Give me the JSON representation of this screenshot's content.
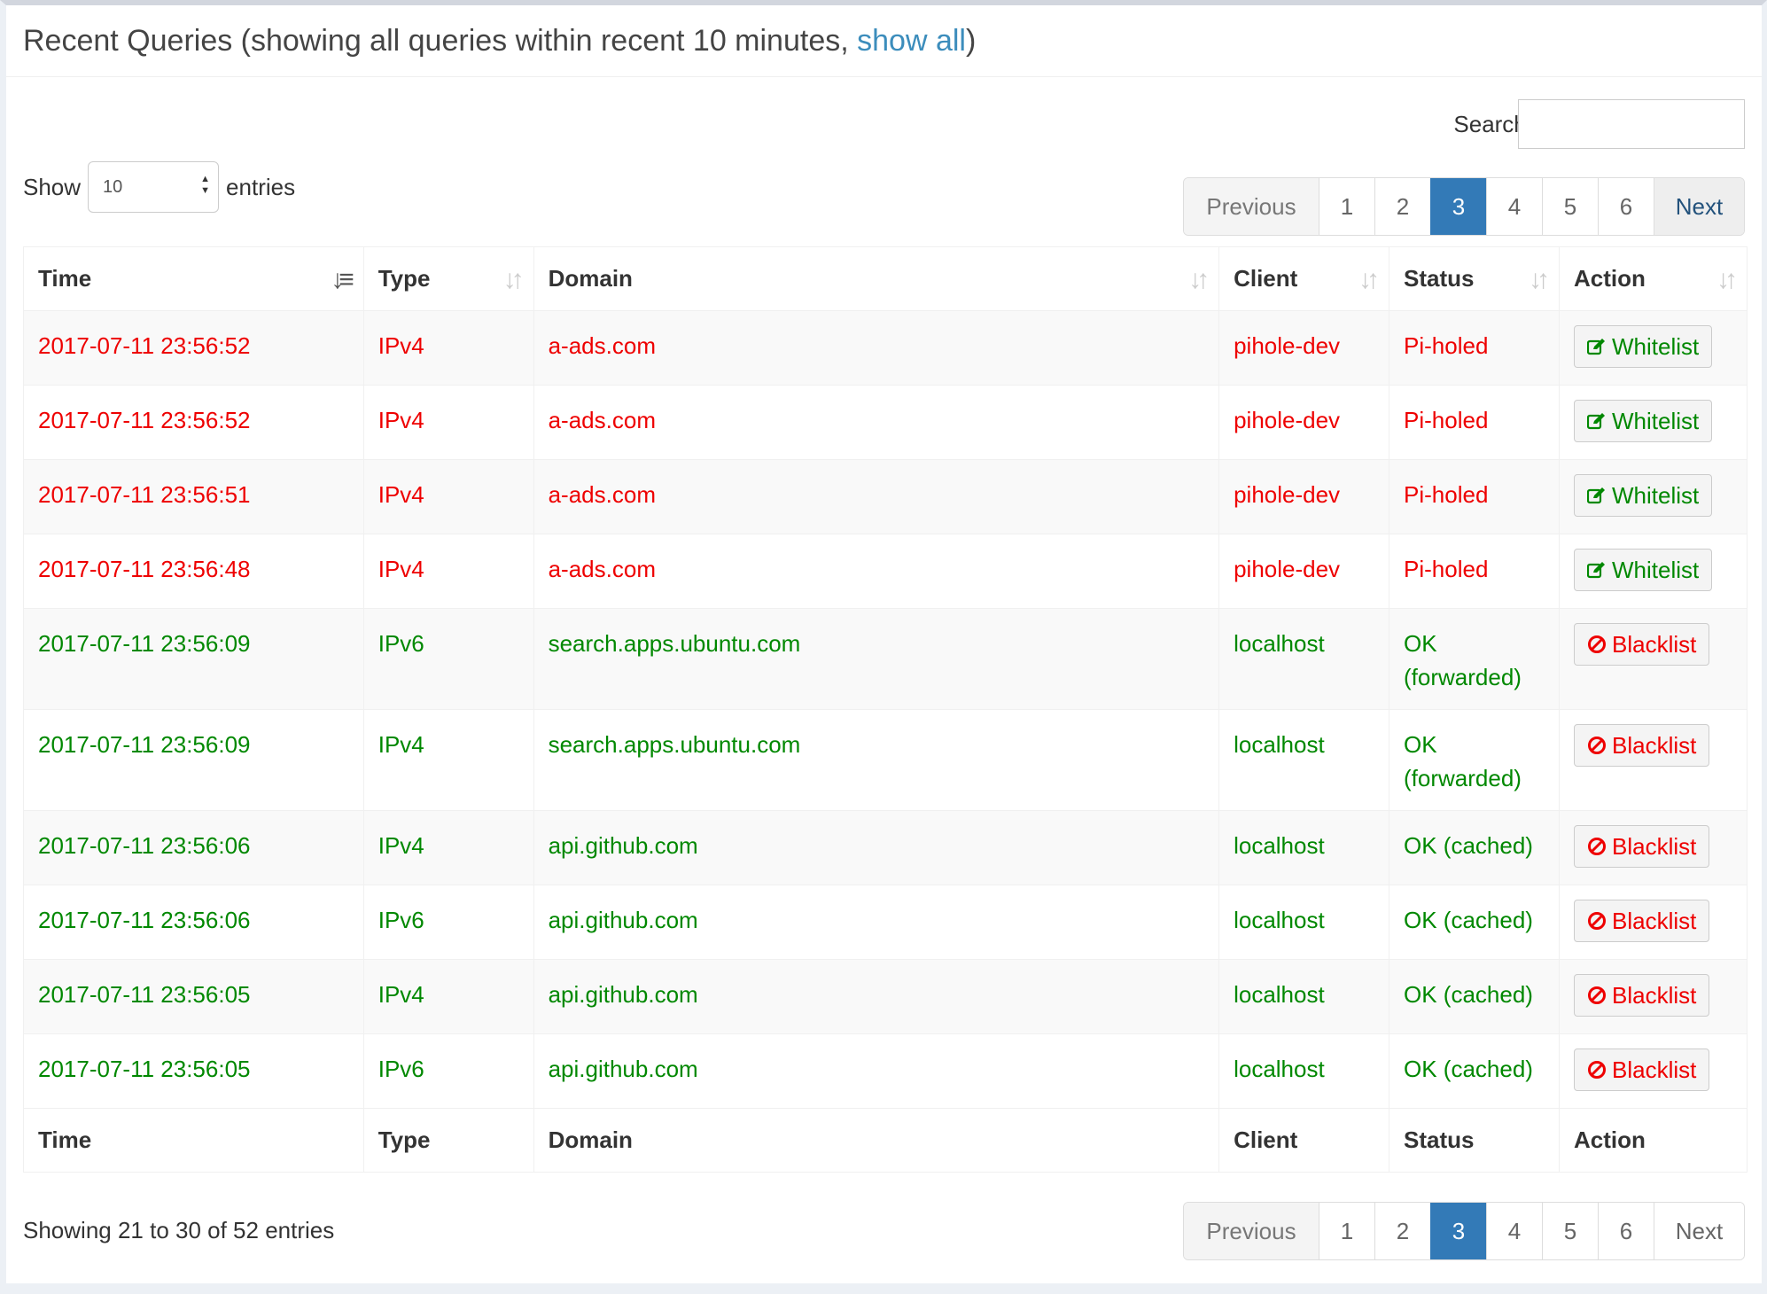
{
  "header": {
    "title_prefix": "Recent Queries (showing all queries within recent 10 minutes, ",
    "show_all_link": "show all",
    "title_suffix": ")"
  },
  "search": {
    "label": "Search:",
    "value": ""
  },
  "length": {
    "show": "Show",
    "value": "10",
    "entries": "entries"
  },
  "pagination": {
    "previous": "Previous",
    "pages": [
      "1",
      "2",
      "3",
      "4",
      "5",
      "6"
    ],
    "active": "3",
    "next": "Next"
  },
  "table": {
    "columns": [
      "Time",
      "Type",
      "Domain",
      "Client",
      "Status",
      "Action"
    ],
    "rows": [
      {
        "time": "2017-07-11 23:56:52",
        "type": "IPv4",
        "domain": "a-ads.com",
        "client": "pihole-dev",
        "status": "Pi-holed",
        "action": "Whitelist"
      },
      {
        "time": "2017-07-11 23:56:52",
        "type": "IPv4",
        "domain": "a-ads.com",
        "client": "pihole-dev",
        "status": "Pi-holed",
        "action": "Whitelist"
      },
      {
        "time": "2017-07-11 23:56:51",
        "type": "IPv4",
        "domain": "a-ads.com",
        "client": "pihole-dev",
        "status": "Pi-holed",
        "action": "Whitelist"
      },
      {
        "time": "2017-07-11 23:56:48",
        "type": "IPv4",
        "domain": "a-ads.com",
        "client": "pihole-dev",
        "status": "Pi-holed",
        "action": "Whitelist"
      },
      {
        "time": "2017-07-11 23:56:09",
        "type": "IPv6",
        "domain": "search.apps.ubuntu.com",
        "client": "localhost",
        "status": "OK (forwarded)",
        "action": "Blacklist"
      },
      {
        "time": "2017-07-11 23:56:09",
        "type": "IPv4",
        "domain": "search.apps.ubuntu.com",
        "client": "localhost",
        "status": "OK (forwarded)",
        "action": "Blacklist"
      },
      {
        "time": "2017-07-11 23:56:06",
        "type": "IPv4",
        "domain": "api.github.com",
        "client": "localhost",
        "status": "OK (cached)",
        "action": "Blacklist"
      },
      {
        "time": "2017-07-11 23:56:06",
        "type": "IPv6",
        "domain": "api.github.com",
        "client": "localhost",
        "status": "OK (cached)",
        "action": "Blacklist"
      },
      {
        "time": "2017-07-11 23:56:05",
        "type": "IPv4",
        "domain": "api.github.com",
        "client": "localhost",
        "status": "OK (cached)",
        "action": "Blacklist"
      },
      {
        "time": "2017-07-11 23:56:05",
        "type": "IPv6",
        "domain": "api.github.com",
        "client": "localhost",
        "status": "OK (cached)",
        "action": "Blacklist"
      }
    ]
  },
  "info": "Showing 21 to 30 of 52 entries",
  "icons": {
    "whitelist": "edit-icon",
    "blacklist": "ban-icon",
    "sort": "sort-icon"
  },
  "colors": {
    "blocked": "#e00000",
    "ok": "#008000",
    "link": "#3c8dbc",
    "active_page": "#337ab7"
  }
}
